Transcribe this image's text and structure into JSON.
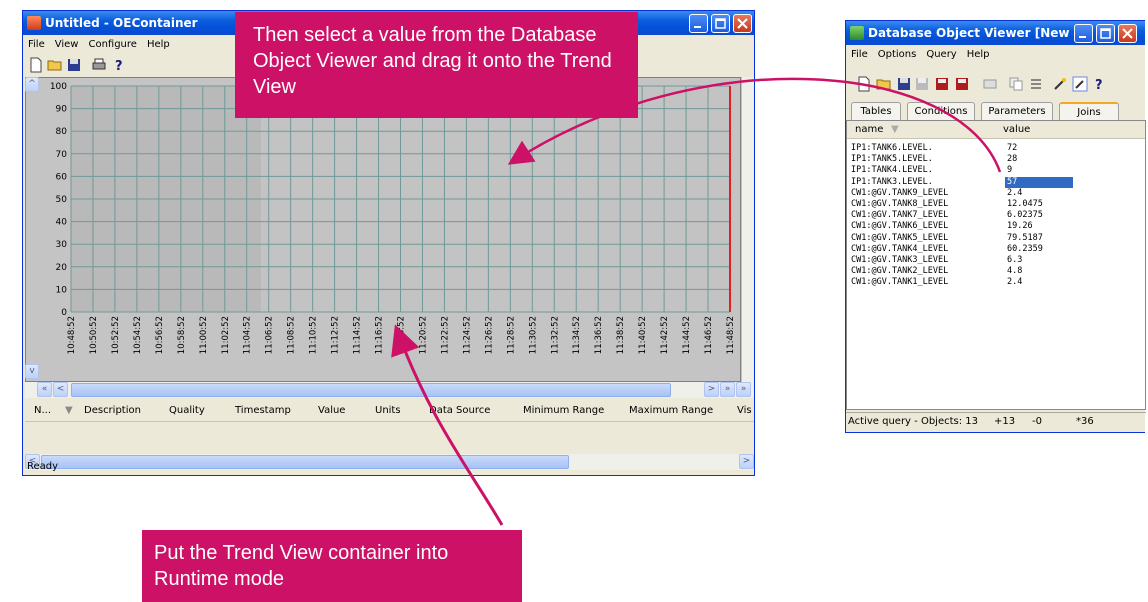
{
  "main_window": {
    "title": "Untitled - OEContainer",
    "menu": [
      "File",
      "View",
      "Configure",
      "Help"
    ],
    "toolbar_icons": [
      "new-icon",
      "open-icon",
      "save-icon",
      "print-icon",
      "help-icon"
    ],
    "chart": {
      "y_ticks": [
        "100",
        "90",
        "80",
        "70",
        "60",
        "50",
        "40",
        "30",
        "20",
        "10",
        "0"
      ],
      "x_ticks": [
        "10:48:52",
        "10:50:52",
        "10:52:52",
        "10:54:52",
        "10:56:52",
        "10:58:52",
        "11:00:52",
        "11:02:52",
        "11:04:52",
        "11:06:52",
        "11:08:52",
        "11:10:52",
        "11:12:52",
        "11:14:52",
        "11:16:52",
        "11:18:52",
        "11:20:52",
        "11:22:52",
        "11:24:52",
        "11:26:52",
        "11:28:52",
        "11:30:52",
        "11:32:52",
        "11:34:52",
        "11:36:52",
        "11:38:52",
        "11:40:52",
        "11:42:52",
        "11:44:52",
        "11:46:52",
        "11:48:52"
      ]
    },
    "columns": [
      "N...",
      "Description",
      "Quality",
      "Timestamp",
      "Value",
      "Units",
      "Data Source",
      "Minimum Range",
      "Maximum Range",
      "Vis"
    ],
    "status": "Ready"
  },
  "viewer_window": {
    "title": "Database Object Viewer [New ...",
    "menu": [
      "File",
      "Options",
      "Query",
      "Help"
    ],
    "tabs": [
      "Tables",
      "Conditions",
      "Parameters",
      "Joins"
    ],
    "columns": [
      "name",
      "value"
    ],
    "rows": [
      {
        "name": "IP1:TANK6.LEVEL.",
        "value": "72"
      },
      {
        "name": "IP1:TANK5.LEVEL.",
        "value": "28"
      },
      {
        "name": "IP1:TANK4.LEVEL.",
        "value": "9"
      },
      {
        "name": "IP1:TANK3.LEVEL.",
        "value": "57"
      },
      {
        "name": "CW1:@GV.TANK9_LEVEL",
        "value": "2.4"
      },
      {
        "name": "CW1:@GV.TANK8_LEVEL",
        "value": "12.0475"
      },
      {
        "name": "CW1:@GV.TANK7_LEVEL",
        "value": "6.02375"
      },
      {
        "name": "CW1:@GV.TANK6_LEVEL",
        "value": "19.26"
      },
      {
        "name": "CW1:@GV.TANK5_LEVEL",
        "value": "79.5187"
      },
      {
        "name": "CW1:@GV.TANK4_LEVEL",
        "value": "60.2359"
      },
      {
        "name": "CW1:@GV.TANK3_LEVEL",
        "value": "6.3"
      },
      {
        "name": "CW1:@GV.TANK2_LEVEL",
        "value": "4.8"
      },
      {
        "name": "CW1:@GV.TANK1_LEVEL",
        "value": "2.4"
      }
    ],
    "selected_row": 3,
    "status": [
      "Active query - Objects: 13",
      "+13",
      "-0",
      "*36"
    ]
  },
  "callouts": {
    "top": "Then select a value from the Database Object Viewer and drag it onto the Trend View",
    "bottom": "Put the Trend View container into Runtime mode"
  },
  "colors": {
    "callout": "#cc1166",
    "titlebar": "#0a5ddc",
    "selection": "#316ac5"
  }
}
